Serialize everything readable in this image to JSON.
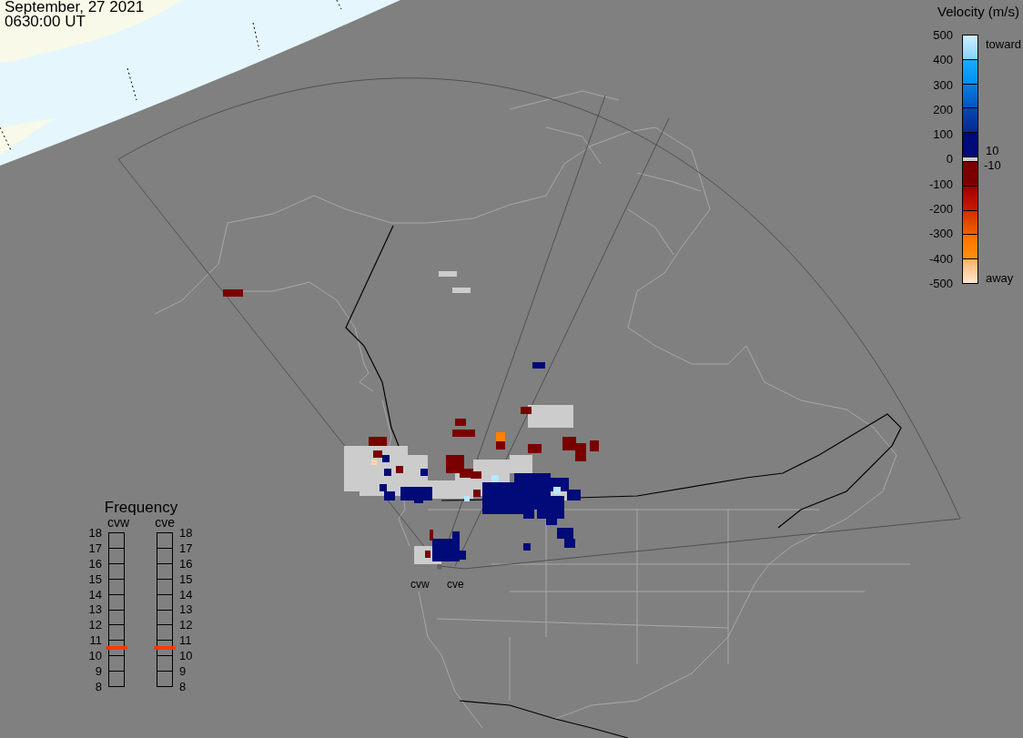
{
  "header": {
    "date": "September, 27 2021",
    "time": "0630:00 UT"
  },
  "velocity_scale": {
    "title": "Velocity (m/s)",
    "ticks": [
      "500",
      "400",
      "300",
      "200",
      "100",
      "0",
      "-100",
      "-200",
      "-300",
      "-400",
      "-500"
    ],
    "upper_end_label": "toward",
    "lower_end_label": "away",
    "positive_threshold": "10",
    "negative_threshold": "-10"
  },
  "frequency_panel": {
    "title": "Frequency",
    "left_ticks": [
      "18",
      "17",
      "16",
      "15",
      "14",
      "13",
      "12",
      "11",
      "10",
      "9",
      "8"
    ],
    "right_ticks": [
      "18",
      "17",
      "16",
      "15",
      "14",
      "13",
      "12",
      "11",
      "10",
      "9",
      "8"
    ],
    "radars": [
      {
        "name": "cvw",
        "level": 0.25
      },
      {
        "name": "cve",
        "level": 0.25
      }
    ]
  },
  "map": {
    "radar_labels": [
      "cvw",
      "cve"
    ]
  }
}
